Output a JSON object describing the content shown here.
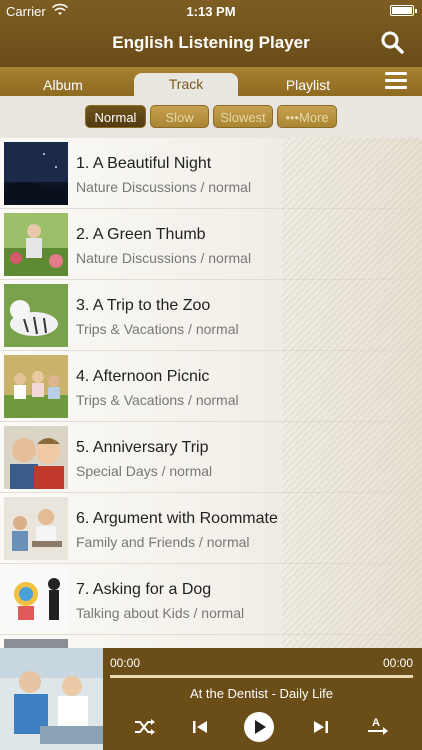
{
  "status_bar": {
    "carrier": "Carrier",
    "time": "1:13 PM"
  },
  "nav": {
    "title": "English Listening Player"
  },
  "tabs": [
    {
      "label": "Album"
    },
    {
      "label": "Track",
      "selected": true
    },
    {
      "label": "Playlist"
    }
  ],
  "speeds": [
    {
      "label": "Normal",
      "selected": true
    },
    {
      "label": "Slow"
    },
    {
      "label": "Slowest"
    },
    {
      "label": "•••More"
    }
  ],
  "tracks": [
    {
      "title": "1. A Beautiful Night",
      "subtitle": "Nature Discussions / normal"
    },
    {
      "title": "2. A Green Thumb",
      "subtitle": "Nature Discussions / normal"
    },
    {
      "title": "3. A Trip to the Zoo",
      "subtitle": "Trips & Vacations / normal"
    },
    {
      "title": "4. Afternoon Picnic",
      "subtitle": "Trips & Vacations / normal"
    },
    {
      "title": "5. Anniversary Trip",
      "subtitle": "Special Days / normal"
    },
    {
      "title": "6. Argument with Roommate",
      "subtitle": "Family and Friends / normal"
    },
    {
      "title": "7. Asking for a Dog",
      "subtitle": "Talking about Kids / normal"
    }
  ],
  "player": {
    "elapsed": "00:00",
    "duration": "00:00",
    "progress": 0,
    "now_playing": "At the Dentist - Daily Life"
  },
  "colors": {
    "header_brown": "#6a4c18",
    "tab_gold": "#a8822f",
    "selected_dark": "#5a4114"
  }
}
